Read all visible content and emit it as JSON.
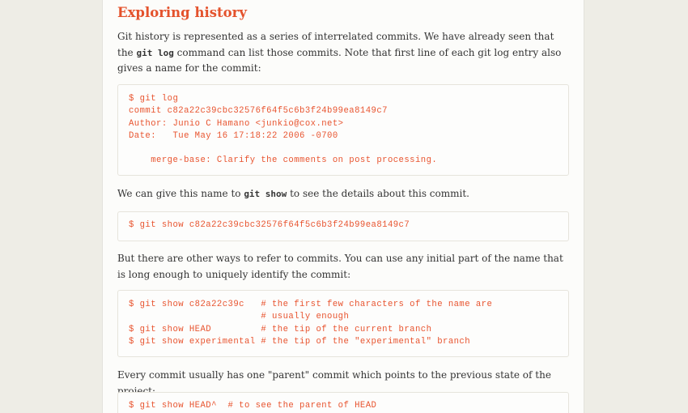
{
  "section": {
    "title": "Exploring history"
  },
  "para1": {
    "text_before": "Git history is represented as a series of interrelated commits. We have already seen that the ",
    "code": "git log",
    "text_after": " command can list those commits. Note that first line of each git log entry also gives a name for the commit:"
  },
  "code1": {
    "lines": [
      "$ git log",
      "commit c82a22c39cbc32576f64f5c6b3f24b99ea8149c7",
      "Author: Junio C Hamano <junkio@cox.net>",
      "Date:   Tue May 16 17:18:22 2006 -0700",
      "",
      "    merge-base: Clarify the comments on post processing."
    ]
  },
  "para2": {
    "text_before": "We can give this name to ",
    "code": "git show",
    "text_after": " to see the details about this commit."
  },
  "code2": {
    "lines": [
      "$ git show c82a22c39cbc32576f64f5c6b3f24b99ea8149c7"
    ]
  },
  "para3": {
    "text": "But there are other ways to refer to commits. You can use any initial part of the name that is long enough to uniquely identify the commit:"
  },
  "code3": {
    "lines": [
      "$ git show c82a22c39c   # the first few characters of the name are",
      "                        # usually enough",
      "$ git show HEAD         # the tip of the current branch",
      "$ git show experimental # the tip of the \"experimental\" branch"
    ]
  },
  "para4": {
    "text": "Every commit usually has one \"parent\" commit which points to the previous state of the project:"
  },
  "code4": {
    "lines": [
      "$ git show HEAD^  # to see the parent of HEAD"
    ]
  },
  "colors": {
    "heading": "#e4522c",
    "code": "#e8542f",
    "body_text": "#343434",
    "background": "#eeede6",
    "page": "#fcfcfa"
  }
}
